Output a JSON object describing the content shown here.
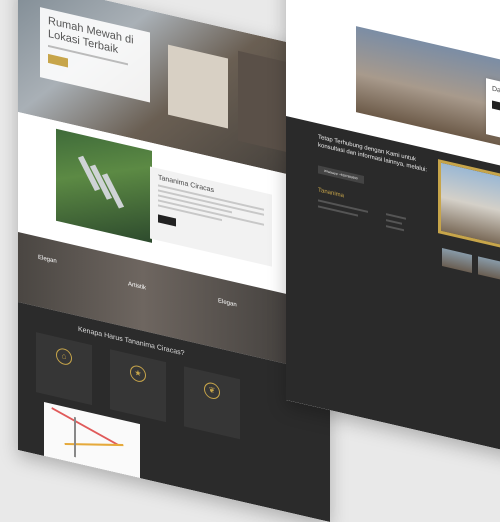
{
  "hero": {
    "title": "Rumah Mewah di Lokasi Terbaik"
  },
  "about": {
    "title": "Tananima Ciracas"
  },
  "types": {
    "labels": [
      "Elegan",
      "Artistik",
      "Elegan"
    ]
  },
  "why": {
    "title": "Kenapa Harus Tananima Ciracas?"
  },
  "right": {
    "list_title": "Dafta",
    "cta": "Tetap Terhubung dengan Kami untuk konsultasi dan informasi lainnya, melalui:",
    "wa_button": "Whatsapp: +6287883699",
    "footer_logo": "Tananima"
  }
}
